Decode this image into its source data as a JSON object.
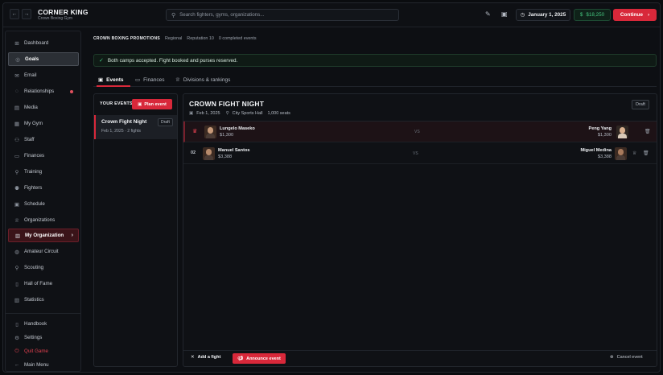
{
  "header": {
    "title": "CORNER KING",
    "subtitle": "Crown Boxing Gym",
    "search_placeholder": "Search fighters, gyms, organizations...",
    "date": "January 1, 2025",
    "money": "$18,250",
    "continue_label": "Continue"
  },
  "sidebar": {
    "items": [
      {
        "label": "Dashboard",
        "icon": "dashboard-icon"
      },
      {
        "label": "Goals",
        "icon": "target-icon"
      },
      {
        "label": "Email",
        "icon": "mail-icon"
      },
      {
        "label": "Relationships",
        "icon": "chat-icon"
      },
      {
        "label": "Media",
        "icon": "media-icon"
      },
      {
        "label": "My Gym",
        "icon": "gym-icon"
      },
      {
        "label": "Staff",
        "icon": "staff-icon"
      },
      {
        "label": "Finances",
        "icon": "finances-icon"
      },
      {
        "label": "Training",
        "icon": "training-icon"
      },
      {
        "label": "Fighters",
        "icon": "fighters-icon"
      },
      {
        "label": "Schedule",
        "icon": "calendar-icon"
      },
      {
        "label": "Organizations",
        "icon": "trophy-icon"
      },
      {
        "label": "My Organization",
        "icon": "building-icon"
      },
      {
        "label": "Amateur Circuit",
        "icon": "circuit-icon"
      },
      {
        "label": "Scouting",
        "icon": "scouting-icon"
      },
      {
        "label": "Hall of Fame",
        "icon": "hall-icon"
      },
      {
        "label": "Statistics",
        "icon": "chart-icon"
      }
    ],
    "bottom": [
      {
        "label": "Handbook",
        "icon": "book-icon"
      },
      {
        "label": "Settings",
        "icon": "gear-icon"
      },
      {
        "label": "Quit Game",
        "icon": "power-icon"
      },
      {
        "label": "Main Menu",
        "icon": "arrow-left-icon"
      }
    ]
  },
  "breadcrumb": {
    "org": "CROWN BOXING PROMOTIONS",
    "tier": "Regional",
    "reputation": "Reputation 10",
    "events": "0 completed events"
  },
  "banner": {
    "text": "Both camps accepted. Fight booked and purses reserved."
  },
  "tabs": [
    {
      "label": "Events"
    },
    {
      "label": "Finances"
    },
    {
      "label": "Divisions & rankings"
    }
  ],
  "events_panel": {
    "title": "YOUR EVENTS",
    "plan_label": "Plan event",
    "items": [
      {
        "name": "Crown Fight Night",
        "meta": "Feb 1, 2025 · 2 fights",
        "status": "Draft"
      }
    ]
  },
  "event_detail": {
    "title": "CROWN FIGHT NIGHT",
    "status": "Draft",
    "date": "Feb 1, 2025",
    "venue": "City Sports Hall",
    "seats": "1,000 seats",
    "vs_label": "VS",
    "bouts": [
      {
        "num": "",
        "main_event": true,
        "left": {
          "name": "Lungelo Maseko",
          "purse": "$1,300"
        },
        "right": {
          "name": "Peng Yang",
          "purse": "$1,300"
        }
      },
      {
        "num": "02",
        "main_event": false,
        "left": {
          "name": "Manuel Santos",
          "purse": "$3,388"
        },
        "right": {
          "name": "Miguel Medina",
          "purse": "$3,388"
        }
      }
    ],
    "add_fight_label": "Add a fight",
    "announce_label": "Announce event",
    "cancel_label": "Cancel event"
  }
}
